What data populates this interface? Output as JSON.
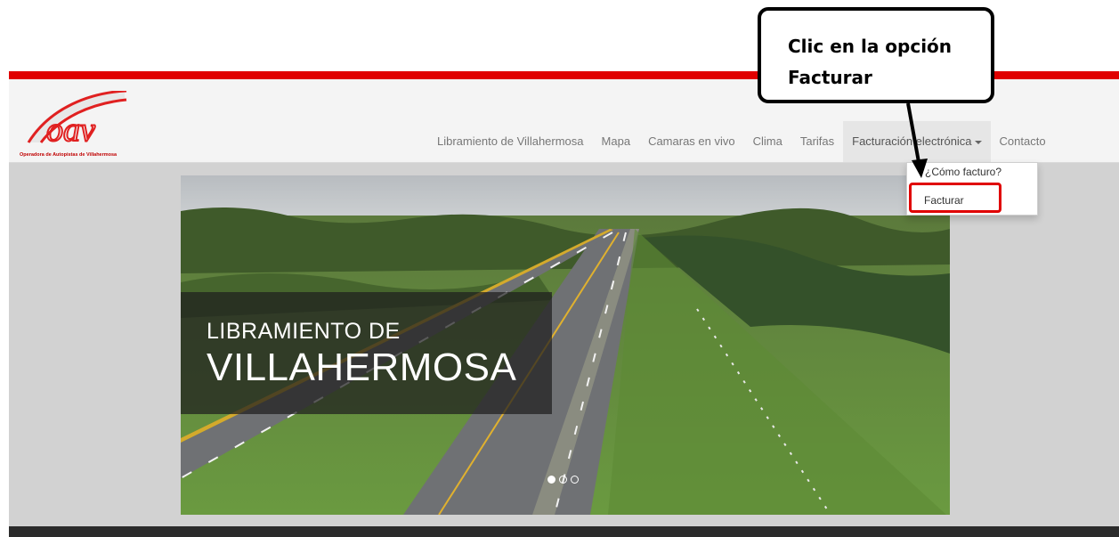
{
  "logo": {
    "text": "oav",
    "tagline": "Operadora de Autopistas de Villahermosa"
  },
  "nav": {
    "items": [
      {
        "label": "Libramiento de Villahermosa"
      },
      {
        "label": "Mapa"
      },
      {
        "label": "Camaras en vivo"
      },
      {
        "label": "Clima"
      },
      {
        "label": "Tarifas"
      },
      {
        "label": "Facturación electrónica"
      },
      {
        "label": "Contacto"
      }
    ]
  },
  "dropdown": {
    "items": [
      {
        "label": "¿Cómo facturo?"
      },
      {
        "label": "Facturar"
      }
    ]
  },
  "carousel": {
    "caption_line1": "LIBRAMIENTO DE",
    "caption_line2": "VILLAHERMOSA",
    "slide_count": 3,
    "active_slide": 1
  },
  "callout": {
    "line1": "Clic en la opción",
    "line2": "Facturar"
  },
  "colors": {
    "brand_red": "#e00000",
    "caption_bg": "#1e1e1e"
  }
}
